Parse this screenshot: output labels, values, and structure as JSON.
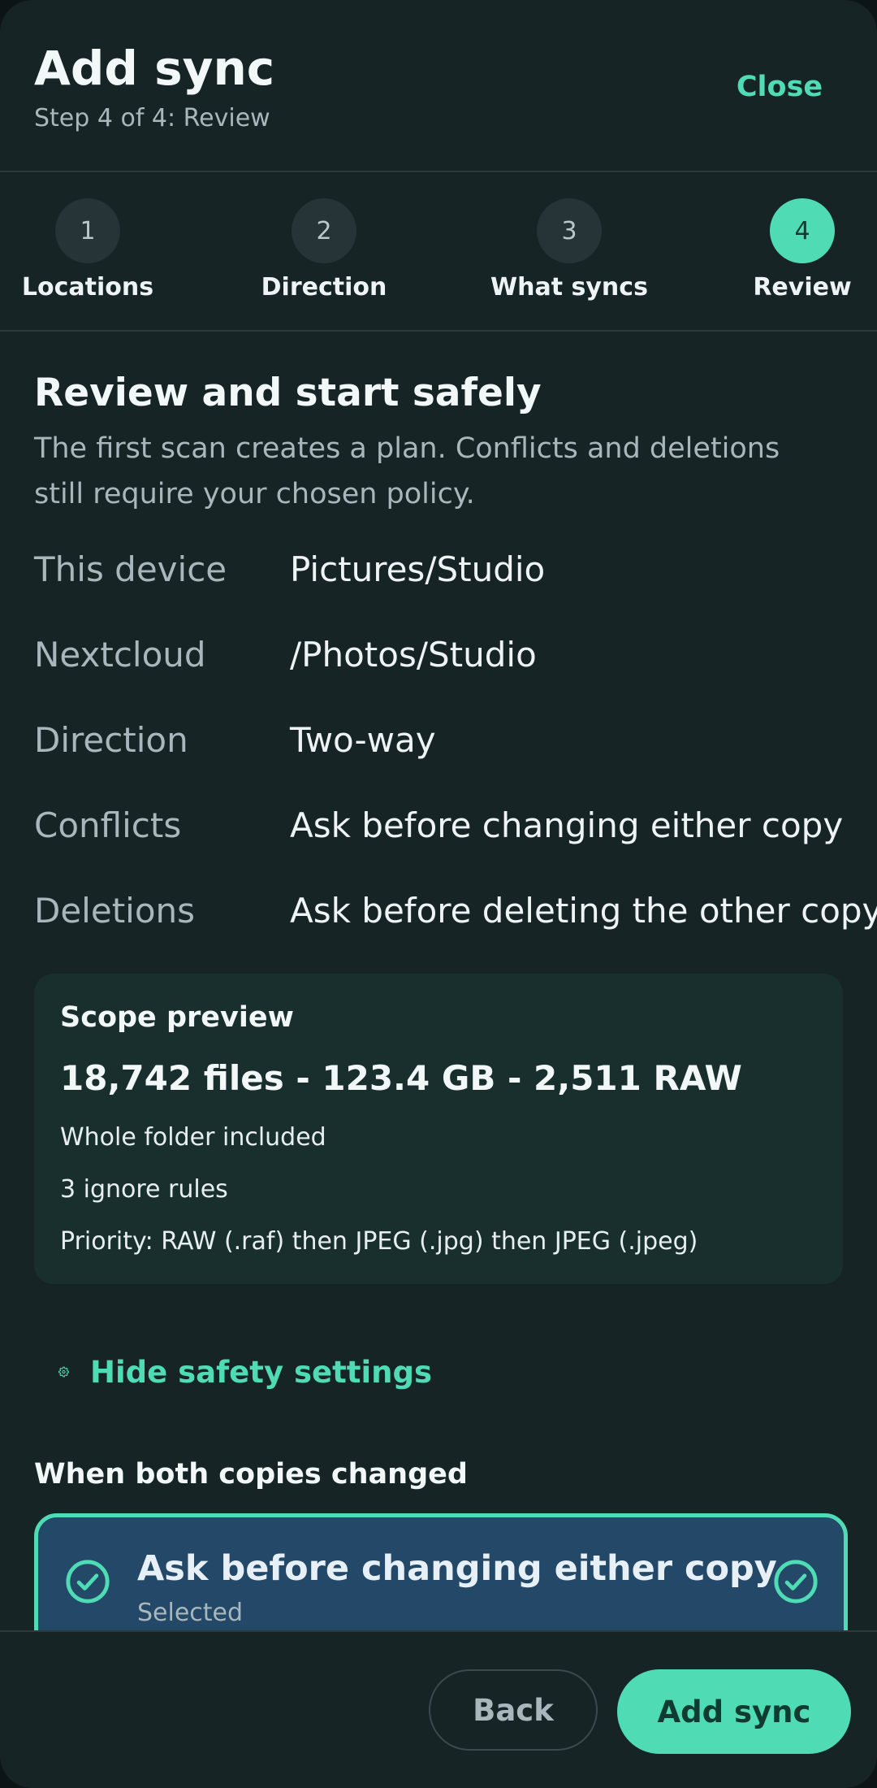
{
  "header": {
    "title": "Add sync",
    "subtitle": "Step 4 of 4: Review",
    "close_label": "Close"
  },
  "stepper": {
    "steps": [
      {
        "number": "1",
        "label": "Locations"
      },
      {
        "number": "2",
        "label": "Direction"
      },
      {
        "number": "3",
        "label": "What syncs"
      },
      {
        "number": "4",
        "label": "Review"
      }
    ],
    "active_step": 4
  },
  "review": {
    "title": "Review and start safely",
    "description": "The first scan creates a plan. Conflicts and deletions still require your chosen policy.",
    "rows": [
      {
        "key": "This device",
        "value": "Pictures/Studio"
      },
      {
        "key": "Nextcloud",
        "value": "/Photos/Studio"
      },
      {
        "key": "Direction",
        "value": "Two-way"
      },
      {
        "key": "Conflicts",
        "value": "Ask before changing either copy"
      },
      {
        "key": "Deletions",
        "value": "Ask before deleting the other copy"
      }
    ]
  },
  "scope": {
    "title": "Scope preview",
    "stats": "18,742 files - 123.4 GB - 2,511 RAW",
    "lines": [
      "Whole folder included",
      "3 ignore rules",
      "Priority: RAW (.raf) then JPEG (.jpg) then JPEG (.jpeg)"
    ]
  },
  "safety": {
    "toggle_label": "Hide safety settings",
    "icon": "gear-icon",
    "conflict_heading": "When both copies changed",
    "selected_option": {
      "title": "Ask before changing either copy",
      "subtitle": "Selected",
      "icon": "check-circle-icon"
    }
  },
  "footer": {
    "back_label": "Back",
    "add_label": "Add sync"
  },
  "colors": {
    "background": "#172426",
    "accent": "#4fdcb4",
    "selected_card": "#234868",
    "scope_card": "#192f2e",
    "muted_text": "#a7b7bc"
  }
}
